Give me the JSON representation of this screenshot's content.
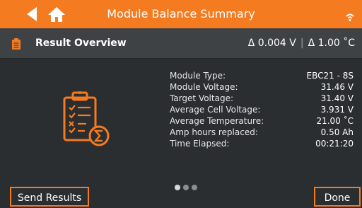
{
  "header": {
    "title": "Module Balance Summary"
  },
  "section": {
    "title": "Result Overview",
    "delta_voltage": "Δ 0.004 V",
    "delta_temp": "Δ 1.00 ˚C",
    "separator": "|"
  },
  "summary": {
    "rows": [
      {
        "label": "Module Type:",
        "value": "EBC21 - 8S"
      },
      {
        "label": "Module Voltage:",
        "value": "31.46 V"
      },
      {
        "label": "Target Voltage:",
        "value": "31.40 V"
      },
      {
        "label": "Average Cell Voltage:",
        "value": "3.931 V"
      },
      {
        "label": "Average Temperature:",
        "value": "21.00 ˚C"
      },
      {
        "label": "Amp hours replaced:",
        "value": "0.50 Ah"
      },
      {
        "label": "Time Elapsed:",
        "value": "00:21:20"
      }
    ]
  },
  "pagination": {
    "pages": 3,
    "active": 0
  },
  "buttons": {
    "send": "Send Results",
    "done": "Done"
  },
  "colors": {
    "accent": "#f47b20",
    "background": "#2b2e30",
    "section_bar": "#3e4245"
  }
}
